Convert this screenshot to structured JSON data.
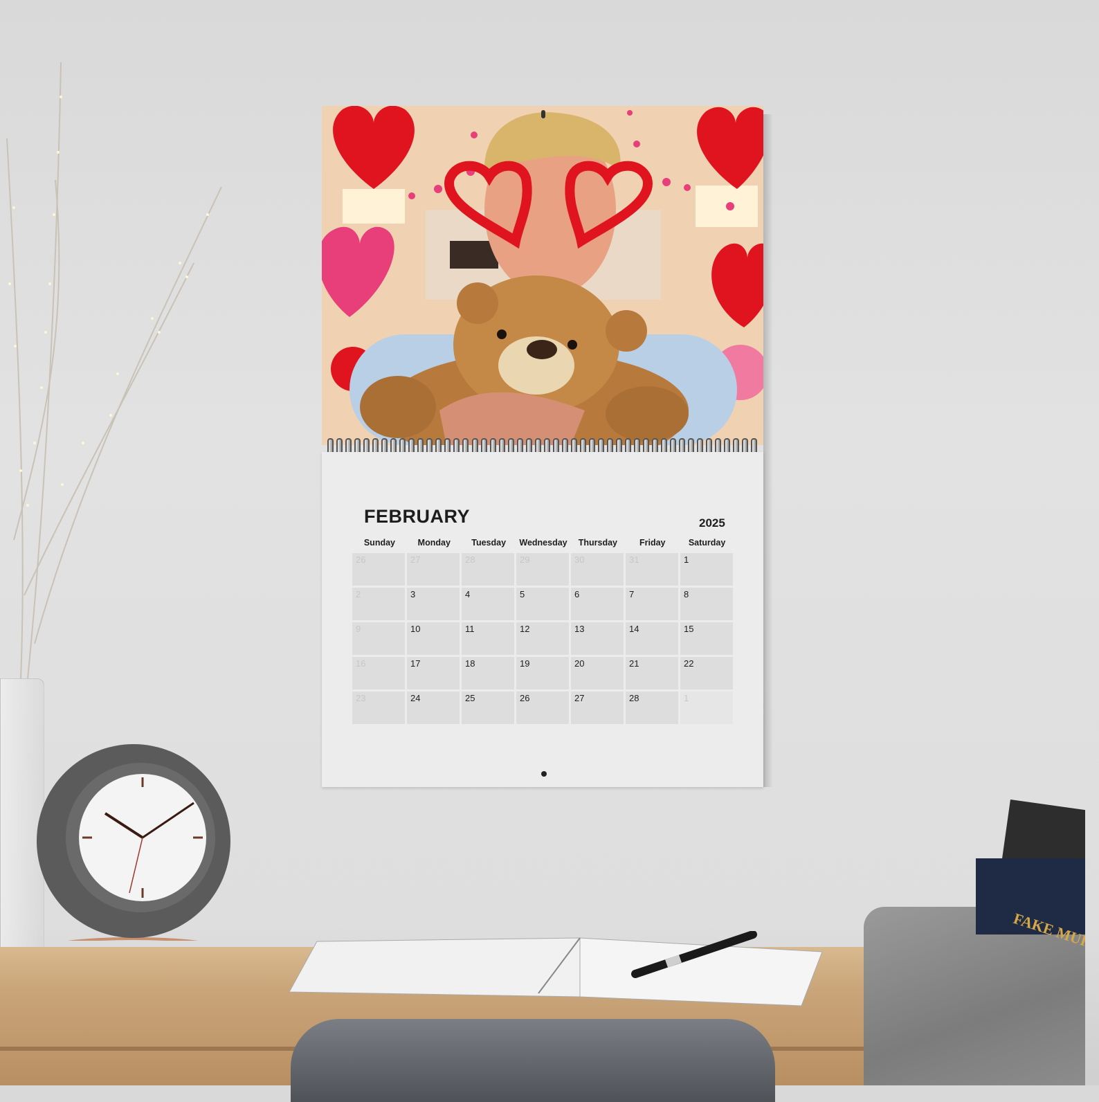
{
  "calendar": {
    "month": "FEBRUARY",
    "year": "2025",
    "weekdays": [
      "Sunday",
      "Monday",
      "Tuesday",
      "Wednesday",
      "Thursday",
      "Friday",
      "Saturday"
    ],
    "days": [
      {
        "label": "26",
        "muted": true
      },
      {
        "label": "27",
        "muted": true
      },
      {
        "label": "28",
        "muted": true
      },
      {
        "label": "29",
        "muted": true
      },
      {
        "label": "30",
        "muted": true
      },
      {
        "label": "31",
        "muted": true
      },
      {
        "label": "1",
        "muted": false
      },
      {
        "label": "2",
        "muted": true
      },
      {
        "label": "3",
        "muted": false
      },
      {
        "label": "4",
        "muted": false
      },
      {
        "label": "5",
        "muted": false
      },
      {
        "label": "6",
        "muted": false
      },
      {
        "label": "7",
        "muted": false
      },
      {
        "label": "8",
        "muted": false
      },
      {
        "label": "9",
        "muted": true
      },
      {
        "label": "10",
        "muted": false
      },
      {
        "label": "11",
        "muted": false
      },
      {
        "label": "12",
        "muted": false
      },
      {
        "label": "13",
        "muted": false
      },
      {
        "label": "14",
        "muted": false
      },
      {
        "label": "15",
        "muted": false
      },
      {
        "label": "16",
        "muted": true
      },
      {
        "label": "17",
        "muted": false
      },
      {
        "label": "18",
        "muted": false
      },
      {
        "label": "19",
        "muted": false
      },
      {
        "label": "20",
        "muted": false
      },
      {
        "label": "21",
        "muted": false
      },
      {
        "label": "22",
        "muted": false
      },
      {
        "label": "23",
        "muted": true
      },
      {
        "label": "24",
        "muted": false
      },
      {
        "label": "25",
        "muted": false
      },
      {
        "label": "26",
        "muted": false
      },
      {
        "label": "27",
        "muted": false
      },
      {
        "label": "28",
        "muted": false
      },
      {
        "label": "1",
        "muted": true
      }
    ]
  },
  "photo": {
    "subject_icon": "teddy-bear-icon",
    "accent_colors": {
      "heart_red": "#e0141f",
      "heart_pink": "#e83e7a",
      "shirt_blue": "#b9cfe6",
      "bear_brown": "#b87a3c"
    }
  },
  "books": {
    "spine_title": "FAKE MURDERS"
  }
}
